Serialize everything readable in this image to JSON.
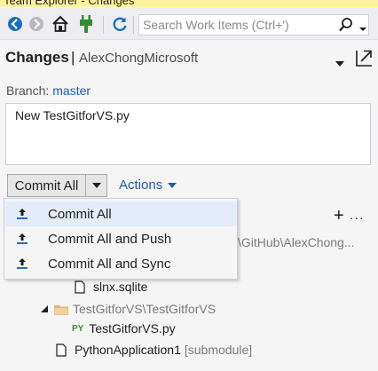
{
  "window": {
    "title": "Team Explorer - Changes"
  },
  "toolbar": {
    "search_placeholder": "Search Work Items (Ctrl+')"
  },
  "header": {
    "title": "Changes",
    "separator": "|",
    "account": "AlexChongMicrosoft"
  },
  "branch": {
    "label": "Branch:",
    "value": "master"
  },
  "commit_message": "New TestGitforVS.py",
  "commit": {
    "label": "Commit All"
  },
  "actions": {
    "label": "Actions"
  },
  "commit_menu": {
    "items": [
      {
        "label": "Commit All",
        "icon": "upload-icon"
      },
      {
        "label": "Commit All and Push",
        "icon": "upload-icon"
      },
      {
        "label": "Commit All and Sync",
        "icon": "upload-icon"
      }
    ]
  },
  "tree": {
    "tools": {
      "add": "+",
      "more": "···"
    },
    "partial_path": "\\GitHub\\AlexChong...",
    "items": [
      {
        "name": "slnx.sqlite",
        "icon": "file-icon"
      },
      {
        "name": "TestGitforVS\\TestGitforVS",
        "icon": "folder-icon"
      },
      {
        "name": "TestGitforVS.py",
        "icon": "python-file-icon",
        "badge": "PY"
      },
      {
        "name": "PythonApplication1",
        "suffix": "[submodule]",
        "icon": "file-icon"
      }
    ]
  },
  "colors": {
    "accent": "#1e5da8",
    "highlight": "#e4ecf9",
    "title_bar": "#fff29d"
  }
}
